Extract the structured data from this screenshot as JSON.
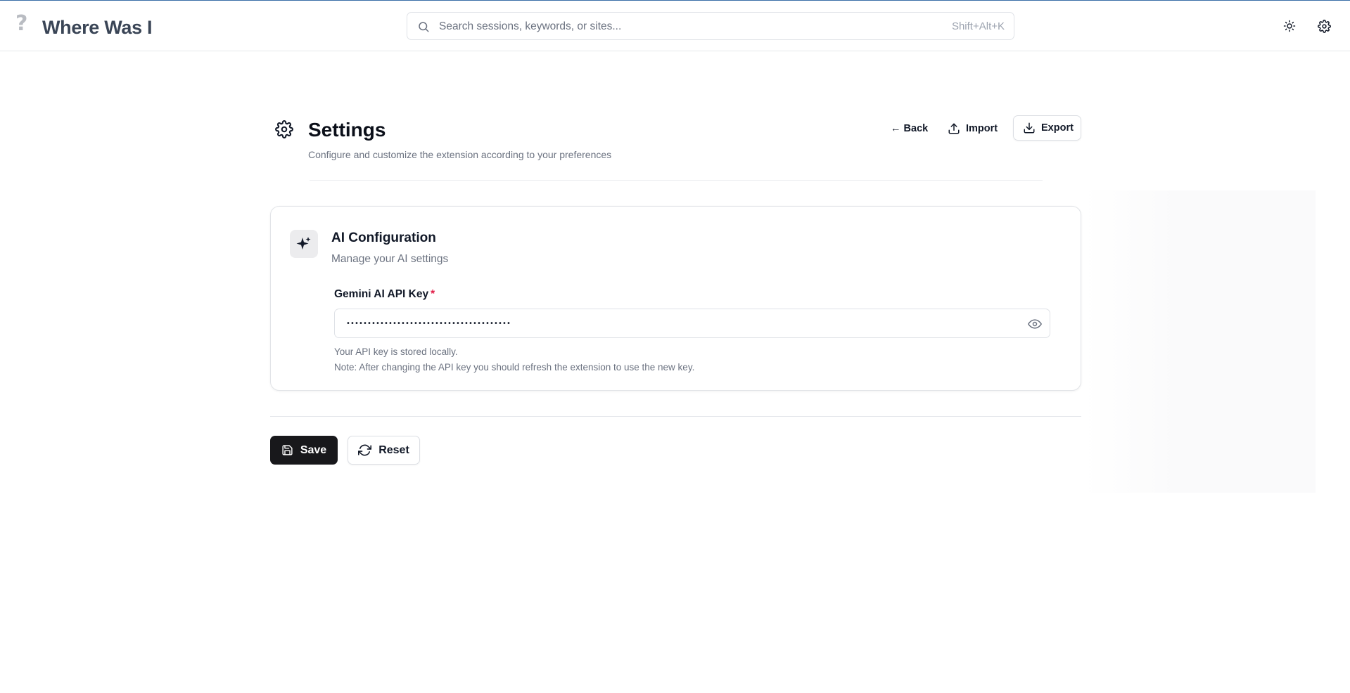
{
  "header": {
    "logo_glyph": "?",
    "app_title": "Where Was I",
    "search": {
      "placeholder": "Search sessions, keywords, or sites...",
      "shortcut": "Shift+Alt+K"
    },
    "icons": [
      "sun-icon",
      "gear-icon"
    ]
  },
  "page": {
    "title": "Settings",
    "subtitle": "Configure and customize the extension according to your preferences",
    "actions": {
      "back": "← Back",
      "import": "Import",
      "export": "Export"
    }
  },
  "ai_config": {
    "title": "AI Configuration",
    "subtitle": "Manage your AI settings",
    "field_label": "Gemini AI API Key",
    "required": "*",
    "masked_value": "•••••••••••••••••••••••••••••••••••••••",
    "help_line_1": "Your API key is stored locally.",
    "help_line_2": "Note: After changing the API key you should refresh the extension to use the new key."
  },
  "footer": {
    "save": "Save",
    "reset": "Reset"
  },
  "colors": {
    "primary_button": "#18181b",
    "required": "#e11d48",
    "muted_text": "#6b7280"
  }
}
